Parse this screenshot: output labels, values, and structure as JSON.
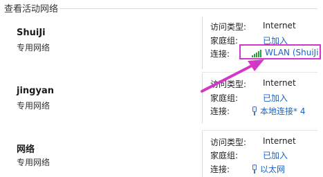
{
  "section_title": "查看活动网络",
  "labels": {
    "access_type": "访问类型:",
    "homegroup": "家庭组:",
    "connection": "连接:"
  },
  "networks": [
    {
      "name": "ShuiJi",
      "type": "专用网络",
      "access_type": "Internet",
      "homegroup": "已加入",
      "connection": "WLAN (ShuiJi)",
      "connection_icon": "wifi-signal-icon"
    },
    {
      "name": "jingyan",
      "type": "专用网络",
      "access_type": "Internet",
      "homegroup": "已加入",
      "connection": "本地连接* 4",
      "connection_icon": "ethernet-icon"
    },
    {
      "name": "网络",
      "type": "专用网络",
      "access_type": "Internet",
      "homegroup": "已加入",
      "connection": "以太网",
      "connection_icon": "ethernet-icon"
    }
  ],
  "colors": {
    "link": "#1a63c6",
    "annotation": "#d437c8",
    "wifi": "#2e9d3c"
  }
}
